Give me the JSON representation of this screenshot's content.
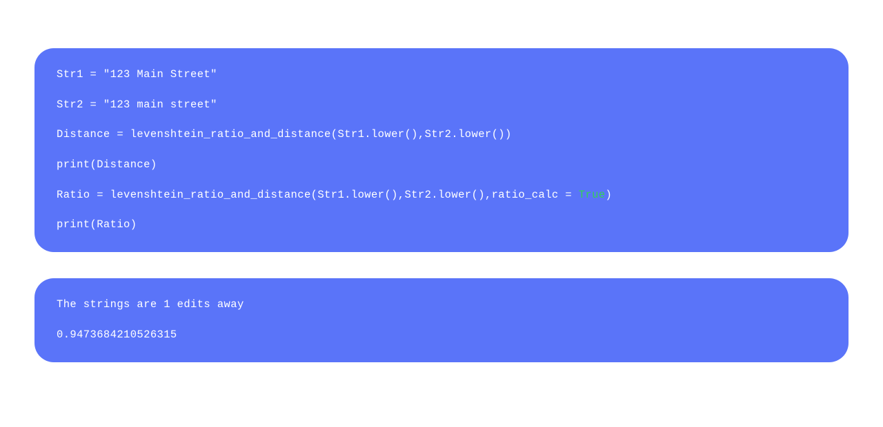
{
  "codeBlock1": {
    "line1_pre": "Str1 = \"123 Main Street\"",
    "line2_pre": "Str2 = \"123 main street\"",
    "line3_pre": "Distance = levenshtein_ratio_and_distance(Str1.lower(),Str2.lower())",
    "line4_pre": "print(Distance)",
    "line5_pre": "Ratio = levenshtein_ratio_and_distance(Str1.lower(),Str2.lower(),ratio_calc = ",
    "line5_keyword": "True",
    "line5_post": ")",
    "line6_pre": "print(Ratio)"
  },
  "codeBlock2": {
    "line1": "The strings are 1 edits away",
    "line2": "0.9473684210526315"
  },
  "colors": {
    "blockBackground": "#5a74f9",
    "text": "#ffffff",
    "keyword": "#34d058"
  }
}
